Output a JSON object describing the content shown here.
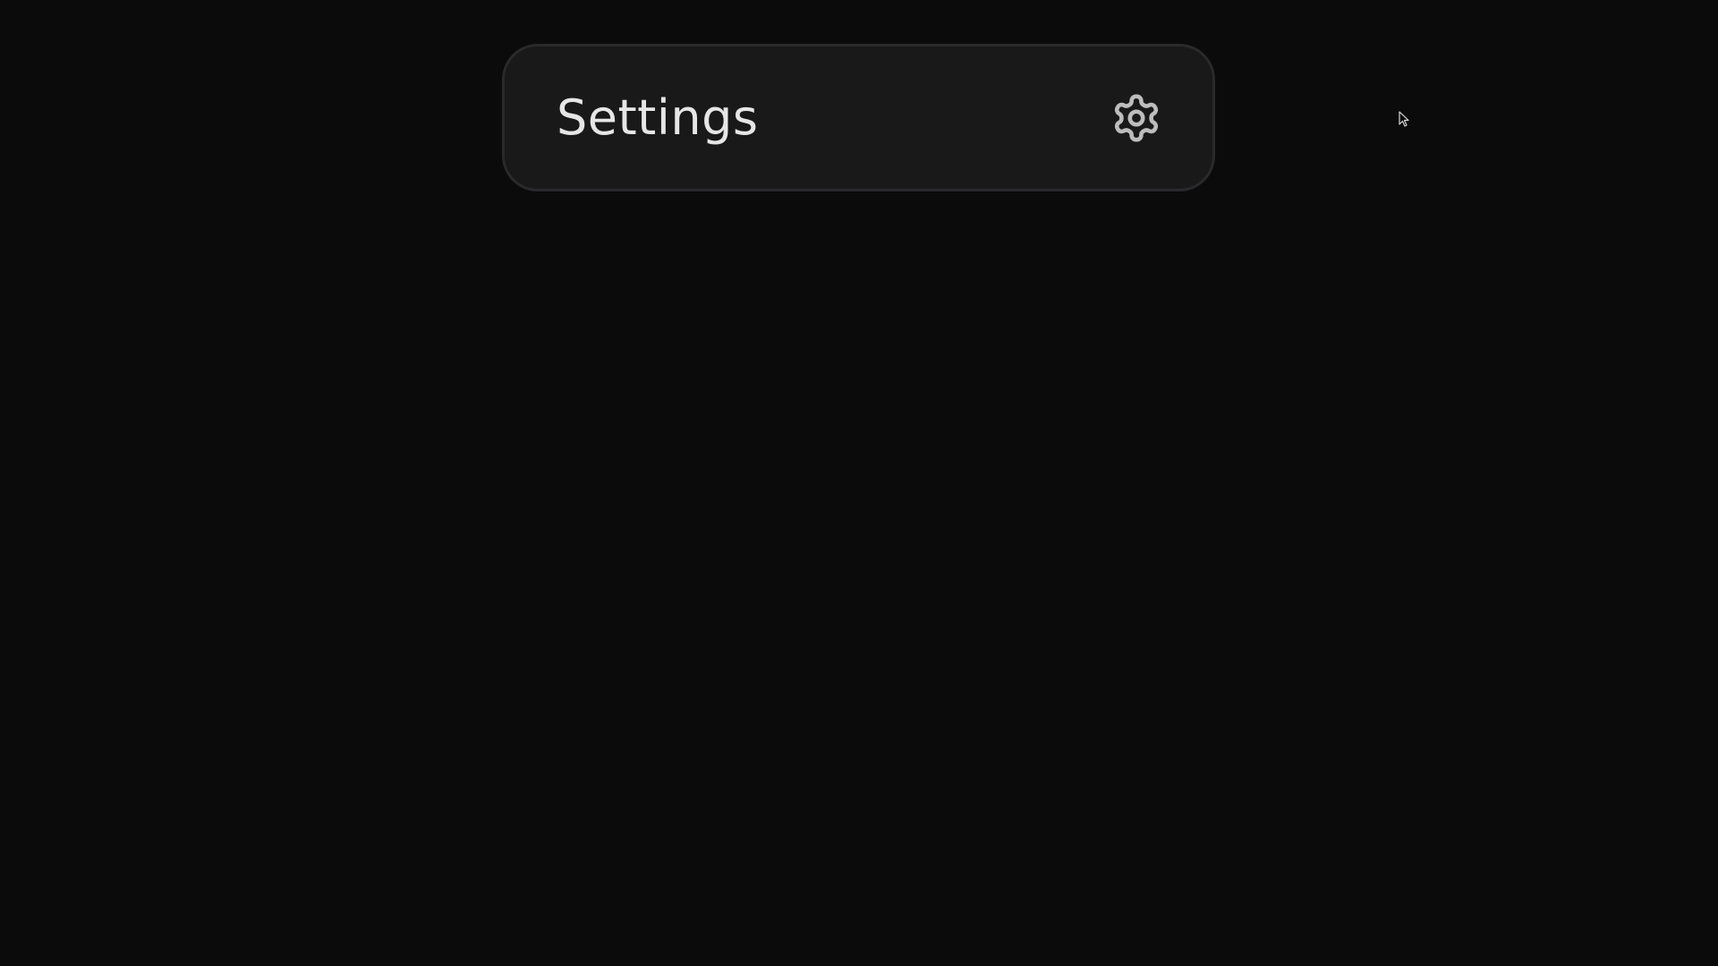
{
  "settings_card": {
    "title": "Settings",
    "icon": "gear-icon"
  },
  "cursor": {
    "icon": "mouse-pointer-icon"
  },
  "colors": {
    "background": "#0b0b0c",
    "card_background": "#19191a",
    "card_border": "#2a2a2c",
    "text": "#e6e6e6",
    "icon": "#bdbdbd"
  }
}
